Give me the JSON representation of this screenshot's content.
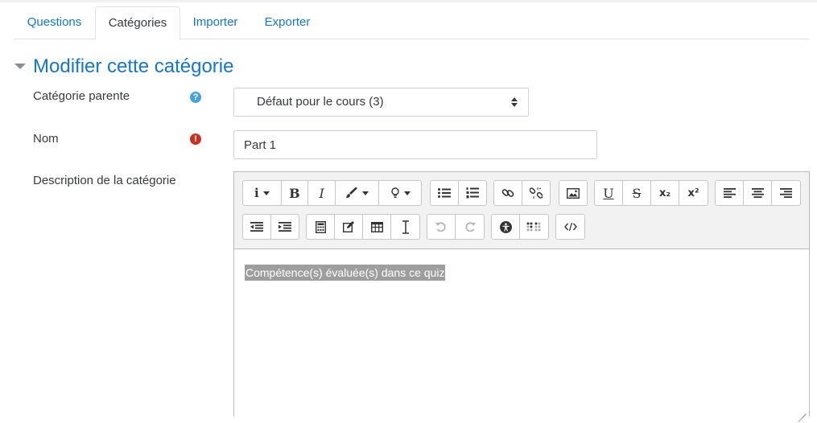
{
  "tabs": [
    {
      "label": "Questions",
      "active": false
    },
    {
      "label": "Catégories",
      "active": true
    },
    {
      "label": "Importer",
      "active": false
    },
    {
      "label": "Exporter",
      "active": false
    }
  ],
  "section": {
    "title": "Modifier cette catégorie"
  },
  "form": {
    "parent_label": "Catégorie parente",
    "parent_value": "Défaut pour le cours (3)",
    "name_label": "Nom",
    "name_value": "Part 1",
    "description_label": "Description de la catégorie",
    "description_text": "Compétence(s) évaluée(s) dans ce quiz"
  },
  "icons": {
    "help": "?",
    "required": "!",
    "bold": "B",
    "italic": "I",
    "underline": "U",
    "strike": "S",
    "subscript": "x₂",
    "superscript": "x²",
    "info": "i"
  },
  "colors": {
    "link": "#1177d1",
    "help_icon": "#46a4d9",
    "required_icon": "#ca3120",
    "selection": "#9e9e9e"
  }
}
